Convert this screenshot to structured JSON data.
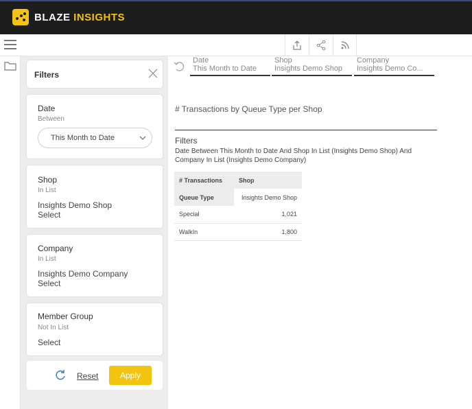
{
  "brand": {
    "word1": "BLAZE",
    "word2": "INSIGHTS"
  },
  "colors": {
    "accent": "#f2c40f",
    "topbar": "#1d1d1d",
    "panel": "#ececec"
  },
  "toolbar": {
    "icons": [
      "upload-icon",
      "share-icon",
      "rss-icon"
    ]
  },
  "filter_panel": {
    "title": "Filters",
    "cards": [
      {
        "title": "Date",
        "operator": "Between",
        "dropdown_value": "This Month to Date"
      },
      {
        "title": "Shop",
        "operator": "In List",
        "value": "Insights Demo Shop",
        "action": "Select"
      },
      {
        "title": "Company",
        "operator": "In List",
        "value": "Insights Demo Company",
        "action": "Select"
      },
      {
        "title": "Member Group",
        "operator": "Not In List",
        "action": "Select"
      }
    ],
    "reset_label": "Reset",
    "apply_label": "Apply"
  },
  "breadcrumbs": [
    {
      "key": "Date",
      "value": "This Month to Date"
    },
    {
      "key": "Shop",
      "value": "Insights Demo Shop"
    },
    {
      "key": "Company",
      "value": "Insights Demo Co..."
    }
  ],
  "report": {
    "title": "# Transactions by Queue Type per Shop",
    "filters_heading": "Filters",
    "filters_description": "Date Between This Month to Date And Shop In List (Insights Demo Shop) And Company In List (Insights Demo Company)",
    "table": {
      "corner": "# Transactions",
      "column_dim": "Shop",
      "row_dim": "Queue Type",
      "column_value": "Insights Demo Shop",
      "rows": [
        {
          "label": "Special",
          "value": "1,021"
        },
        {
          "label": "WalkIn",
          "value": "1,800"
        }
      ]
    }
  }
}
